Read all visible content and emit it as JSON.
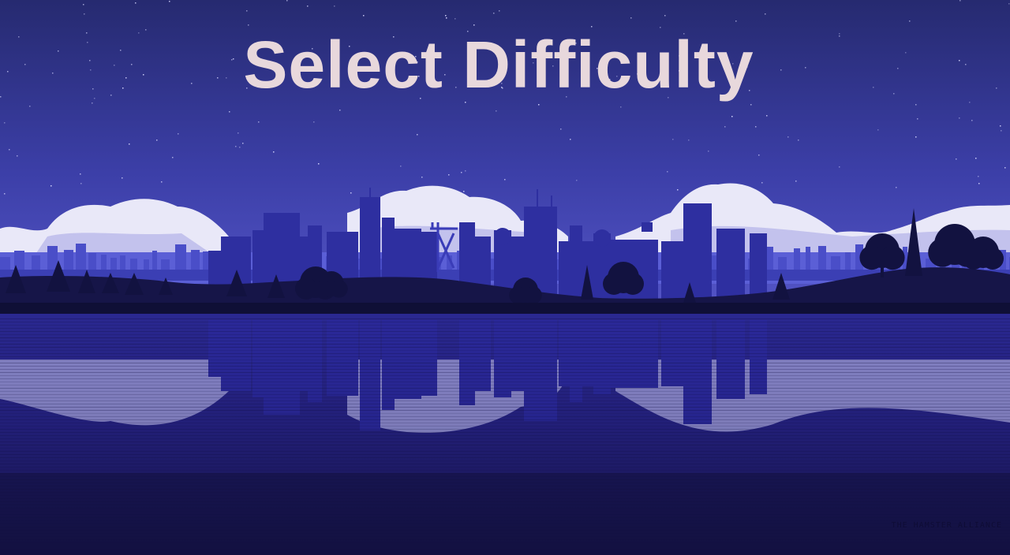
{
  "screen": {
    "title": "Select Difficulty",
    "credit": "THE HAMSTER ALLIANCE"
  },
  "colors": {
    "title_text": "#e8d8dc",
    "sky_top": "#2a2d78",
    "sky_horizon": "#4f50c2",
    "clouds": "#e9e8f8",
    "far_city": "#4a4ec8",
    "main_city": "#2e2fa0",
    "hills": "#12123e",
    "water": "#1e1c68"
  }
}
